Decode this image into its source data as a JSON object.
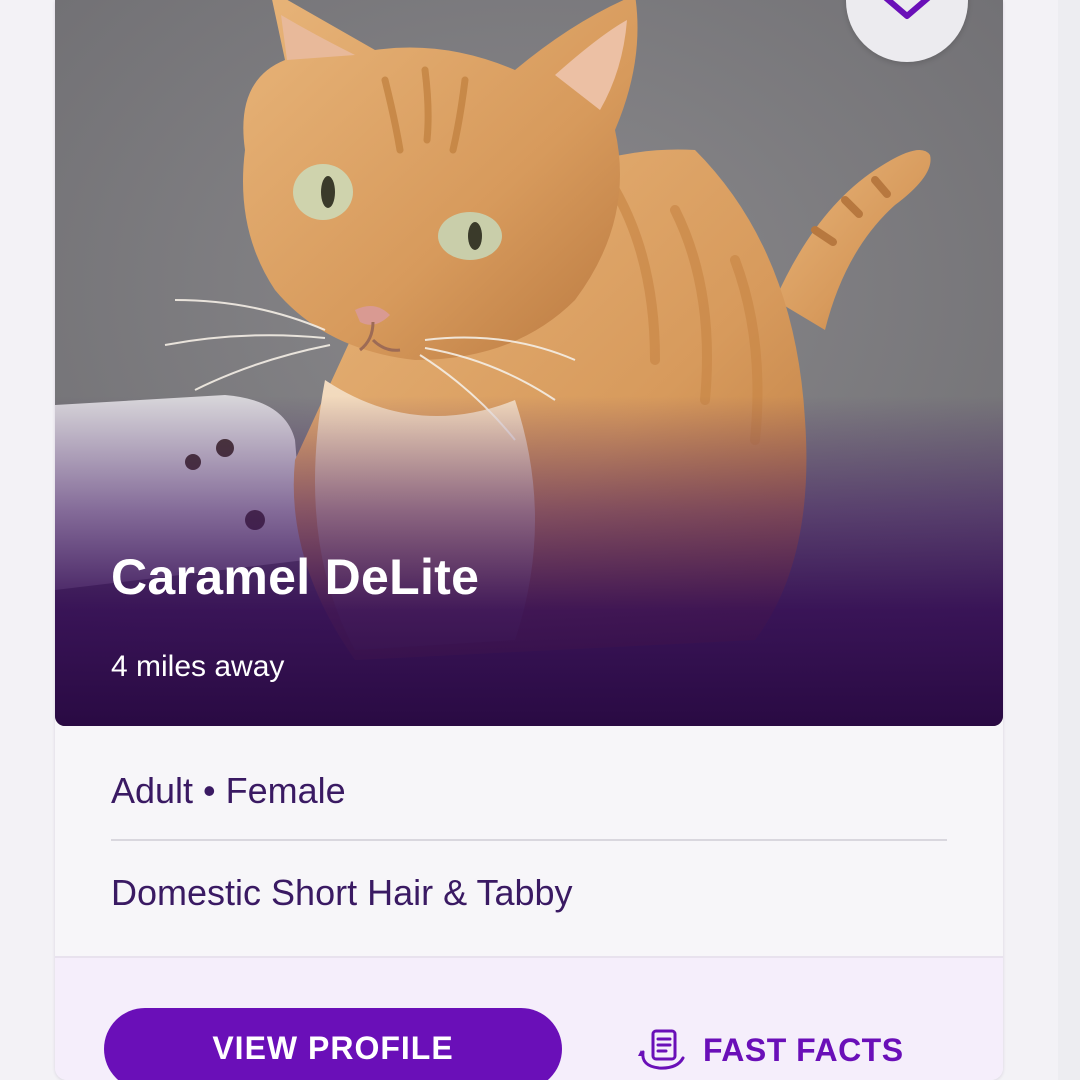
{
  "pet": {
    "name": "Caramel DeLite",
    "distance": "4 miles away",
    "age_gender": "Adult • Female",
    "breed": "Domestic Short Hair & Tabby"
  },
  "actions": {
    "view_profile_label": "VIEW PROFILE",
    "fast_facts_label": "FAST FACTS"
  },
  "icons": {
    "favorite": "heart-outline-icon",
    "fast_facts": "document-icon"
  },
  "colors": {
    "brand_purple": "#6a0fb8",
    "text_dark_purple": "#3a1a63",
    "overlay_purple": "#3c0c5e"
  }
}
